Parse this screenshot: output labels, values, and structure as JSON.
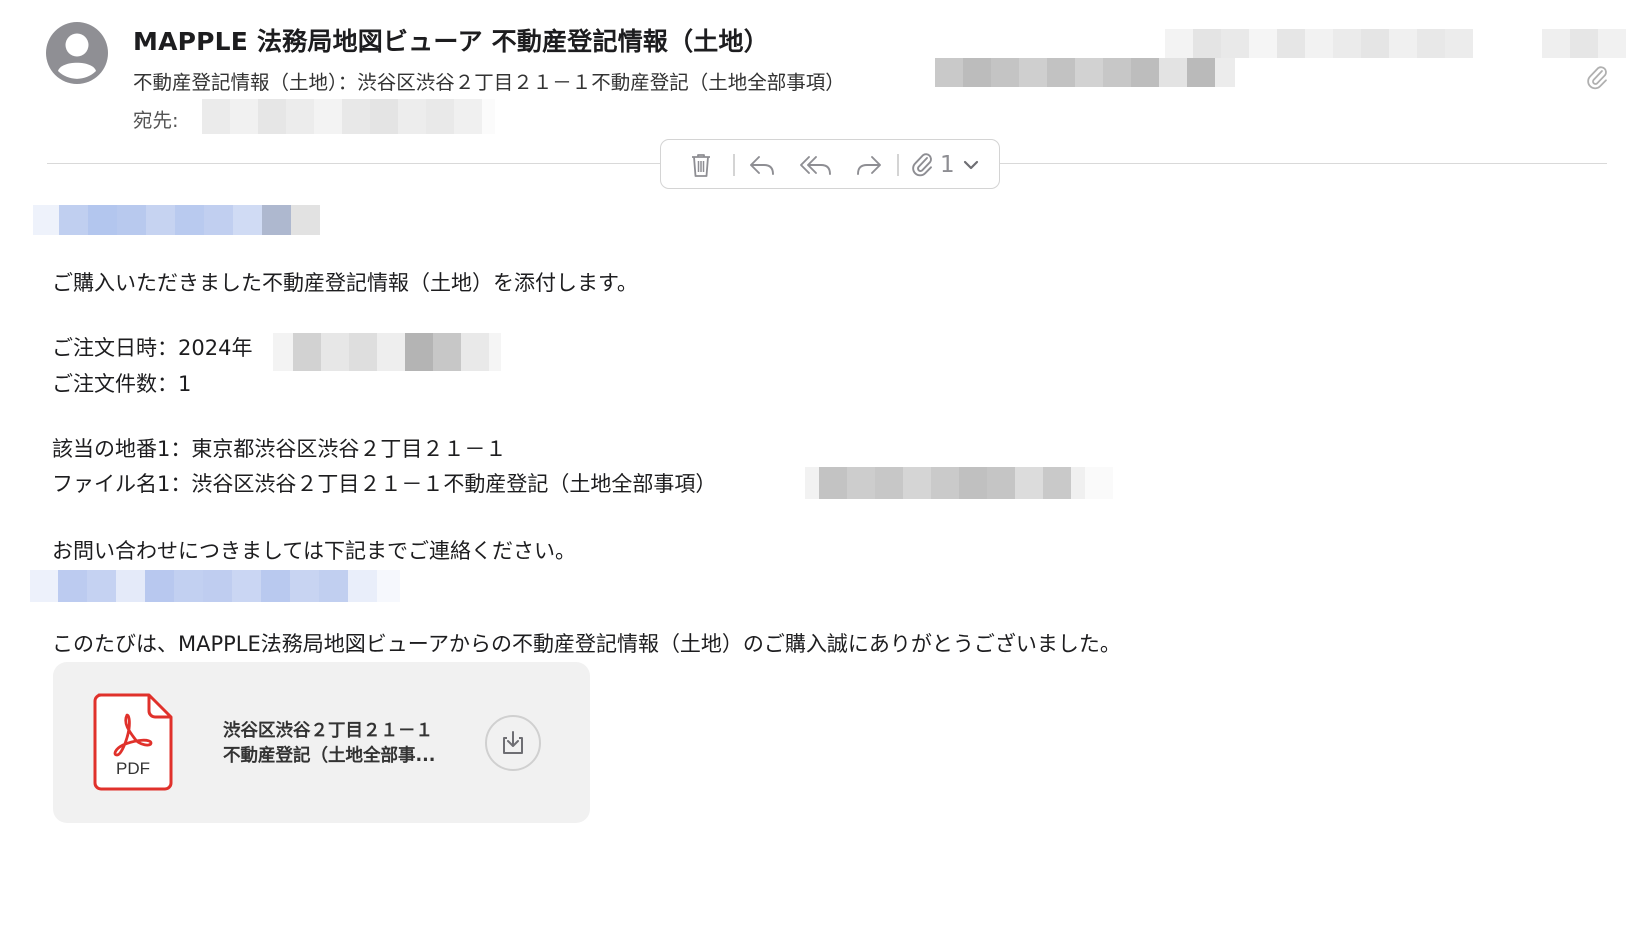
{
  "header": {
    "sender": "MAPPLE 法務局地図ビューア 不動産登記情報（土地）",
    "subject": "不動産登記情報（土地）：渋谷区渋谷２丁目２１－１不動産登記（土地全部事項）",
    "to_label": "宛先:"
  },
  "toolbar": {
    "attachment_count": "1",
    "icons": [
      "trash-icon",
      "reply-icon",
      "reply-all-icon",
      "forward-icon",
      "paperclip-icon",
      "chevron-down-icon"
    ]
  },
  "body": {
    "line1": "ご購入いただきました不動産登記情報（土地）を添付します。",
    "order_date": "ご注文日時：2024年",
    "order_count": "ご注文件数：1",
    "lot": "該当の地番1：東京都渋谷区渋谷２丁目２１－１",
    "filename": "ファイル名1：渋谷区渋谷２丁目２１－１不動産登記（土地全部事項）",
    "contact": "お問い合わせにつきましては下記までご連絡ください。",
    "thanks": "このたびは、MAPPLE法務局地図ビューアからの不動産登記情報（土地）のご購入誠にありがとうございました。"
  },
  "attachment": {
    "name_line1": "渋谷区渋谷２丁目２１－１",
    "name_line2": "不動産登記（土地全部事...",
    "type_label": "PDF"
  },
  "colors": {
    "pdf_red": "#e0312b",
    "icon_gray": "#8e8e93",
    "link_blur": "#bccbea"
  }
}
